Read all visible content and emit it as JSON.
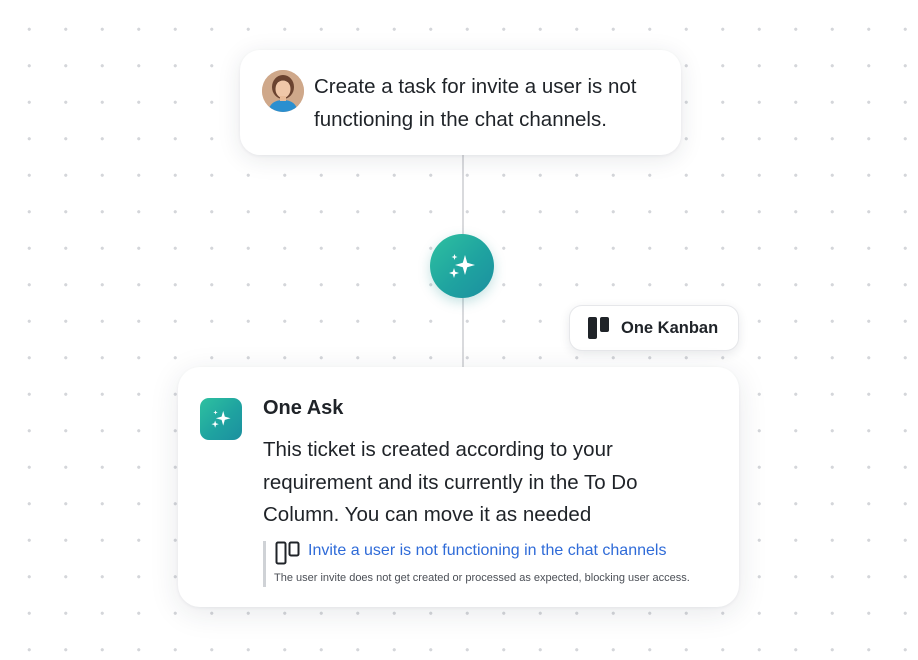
{
  "user_message": {
    "text": "Create a task for invite a user is not functioning in the chat channels."
  },
  "kanban_chip": {
    "label": "One Kanban"
  },
  "answer": {
    "title": "One Ask",
    "body": "This ticket is created according to your requirement and its currently in the To Do Column. You can move it as needed",
    "ticket": {
      "title": "Invite a user is not functioning in the chat channels",
      "description": "The user invite does not get created or processed as expected, blocking user access."
    }
  },
  "colors": {
    "accent_gradient_start": "#2ec1a0",
    "accent_gradient_end": "#1b8f9f",
    "link": "#2f6bd8"
  },
  "icons": {
    "avatar": "user-avatar",
    "ai_node": "sparkles-icon",
    "kanban": "kanban-board-icon",
    "ticket": "kanban-card-icon"
  }
}
